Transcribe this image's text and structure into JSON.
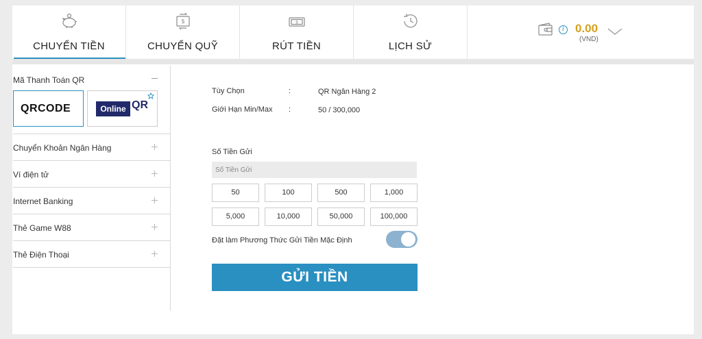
{
  "tabs": [
    {
      "label": "CHUYỂN TIỀN",
      "icon": "piggy-bank-icon",
      "active": true
    },
    {
      "label": "CHUYỂN QUỸ",
      "icon": "transfer-icon"
    },
    {
      "label": "RÚT TIỀN",
      "icon": "cash-icon"
    },
    {
      "label": "LỊCH SỬ",
      "icon": "history-icon"
    }
  ],
  "wallet": {
    "balance": "0.00",
    "currency": "(VND)",
    "info_glyph": "i"
  },
  "menu": {
    "qr_section": {
      "label": "Mã Thanh Toán QR",
      "options": [
        "QRCODE",
        "Online",
        "QR"
      ]
    },
    "items": [
      {
        "label": "Chuyển Khoản Ngân Hàng"
      },
      {
        "label": "Ví điện tử"
      },
      {
        "label": "Internet Banking"
      },
      {
        "label": "Thẻ Game W88"
      },
      {
        "label": "Thẻ Điện Thoại"
      }
    ]
  },
  "details": {
    "option_label": "Tùy Chọn",
    "option_value": "QR Ngân Hàng 2",
    "limit_label": "Giới Hạn Min/Max",
    "limit_value": "50 / 300,000",
    "separator": ":"
  },
  "deposit": {
    "amount_label": "Số Tiền Gửi",
    "amount_placeholder": "Số Tiền Gửi",
    "quick_amounts": [
      "50",
      "100",
      "500",
      "1,000",
      "5,000",
      "10,000",
      "50,000",
      "100,000"
    ],
    "default_label": "Đặt làm Phương Thức Gửi Tiền Mặc Định",
    "default_enabled": true,
    "submit_label": "GỬI TIỀN"
  },
  "colors": {
    "accent": "#2a8fc1",
    "balance": "#d4a21e",
    "toggle": "#8cb2cf"
  }
}
